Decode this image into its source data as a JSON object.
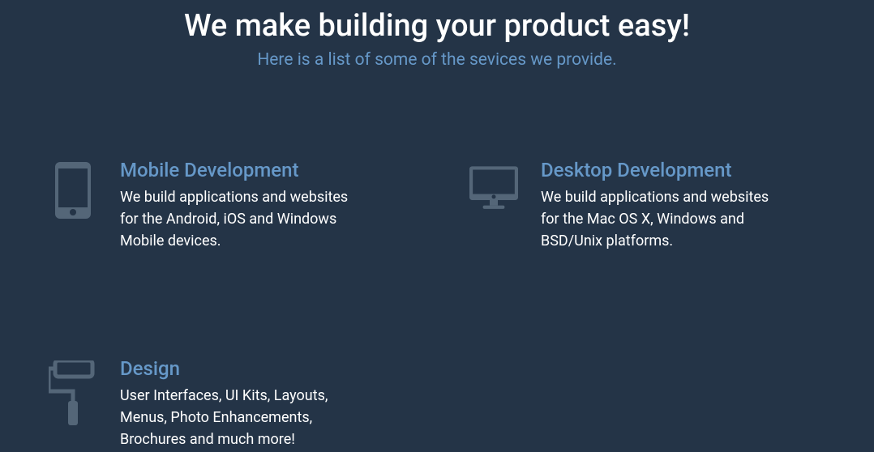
{
  "header": {
    "title": "We make building your product easy!",
    "subtitle": "Here is a list of some of the sevices we provide."
  },
  "services": [
    {
      "title": "Mobile Development",
      "description": "We build applications and websites for the Android, iOS and Windows Mobile devices."
    },
    {
      "title": "Desktop Development",
      "description": "We build applications and websites for the Mac OS X, Windows and BSD/Unix platforms."
    },
    {
      "title": "Design",
      "description": "User Interfaces, UI Kits, Layouts, Menus, Photo Enhancements, Brochures and much more!"
    }
  ]
}
